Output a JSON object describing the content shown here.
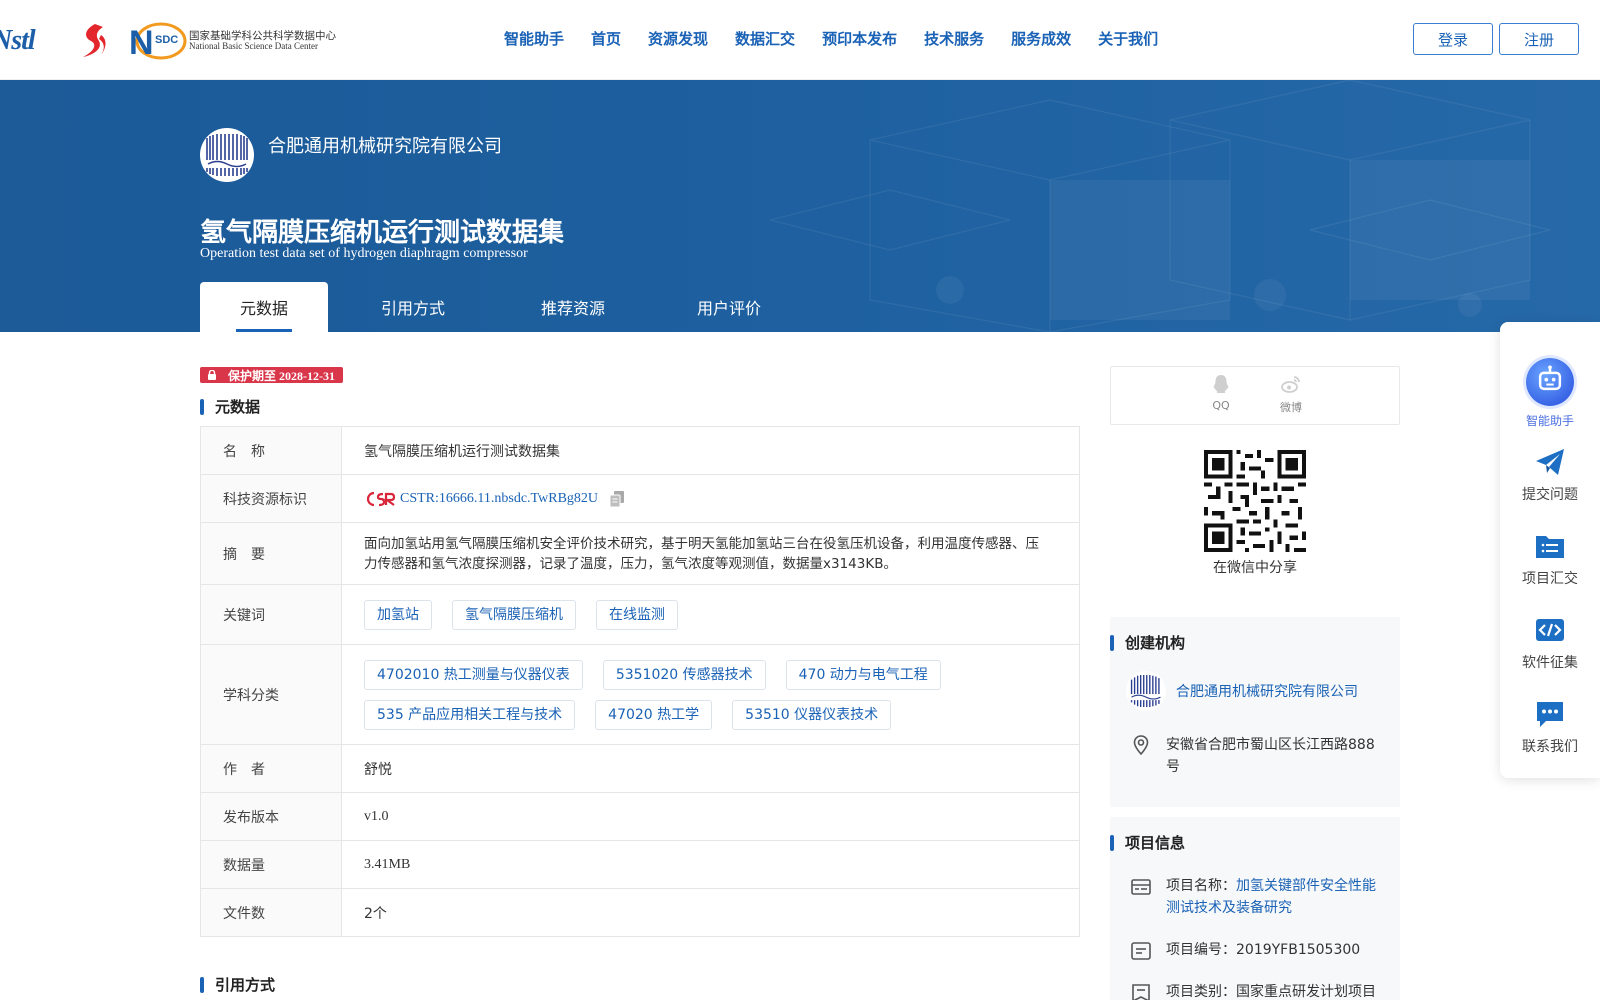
{
  "header": {
    "logos": {
      "nstl": "Nstl",
      "nsdc_mark": "SDC",
      "nsdc_cn": "国家基础学科公共科学数据中心",
      "nsdc_en": "National Basic Science Data Center"
    },
    "nav": [
      "智能助手",
      "首页",
      "资源发现",
      "数据汇交",
      "预印本发布",
      "技术服务",
      "服务成效",
      "关于我们"
    ],
    "login": "登录",
    "register": "注册"
  },
  "banner": {
    "org_name": "合肥通用机械研究院有限公司",
    "title": "氢气隔膜压缩机运行测试数据集",
    "title_en": "Operation test data set of hydrogen diaphragm compressor",
    "tabs": [
      "元数据",
      "引用方式",
      "推荐资源",
      "用户评价"
    ],
    "active_tab": 0
  },
  "protect_badge": "保护期至 2028-12-31",
  "metadata": {
    "section_title": "元数据",
    "rows": {
      "name": {
        "label": "名　称",
        "value": "氢气隔膜压缩机运行测试数据集"
      },
      "cstr": {
        "label": "科技资源标识",
        "value": "CSTR:16666.11.nbsdc.TwRBg82U"
      },
      "abstract": {
        "label": "摘　要",
        "value": "面向加氢站用氢气隔膜压缩机安全评价技术研究，基于明天氢能加氢站三台在役氢压机设备，利用温度传感器、压力传感器和氢气浓度探测器，记录了温度，压力，氢气浓度等观测值，数据量x3143KB。"
      },
      "keywords": {
        "label": "关键词",
        "tags": [
          "加氢站",
          "氢气隔膜压缩机",
          "在线监测"
        ]
      },
      "subjects": {
        "label": "学科分类",
        "rows": [
          [
            "4702010 热工测量与仪器仪表",
            "5351020 传感器技术",
            "470 动力与电气工程"
          ],
          [
            "535 产品应用相关工程与技术",
            "47020 热工学",
            "53510 仪器仪表技术"
          ]
        ]
      },
      "author": {
        "label": "作　者",
        "value": "舒悦"
      },
      "version": {
        "label": "发布版本",
        "value": "v1.0"
      },
      "size": {
        "label": "数据量",
        "value": "3.41MB"
      },
      "files": {
        "label": "文件数",
        "value": "2个"
      }
    }
  },
  "citation_section_title": "引用方式",
  "share": {
    "qq": "QQ",
    "weibo": "微博",
    "wechat_caption": "在微信中分享"
  },
  "org_panel": {
    "title": "创建机构",
    "org_name": "合肥通用机械研究院有限公司",
    "address": "安徽省合肥市蜀山区长江西路888号"
  },
  "project_panel": {
    "title": "项目信息",
    "name_label": "项目名称：",
    "name_value": "加氢关键部件安全性能测试技术及装备研究",
    "number": "项目编号：2019YFB1505300",
    "category": "项目类别：国家重点研发计划项目"
  },
  "float_bar": {
    "ai": "智能助手",
    "submit": "提交问题",
    "project": "项目汇交",
    "software": "软件征集",
    "contact": "联系我们"
  },
  "colors": {
    "brand_blue": "#1a62b5",
    "banner_blue": "#1d5f9f",
    "badge_red": "#d9364a"
  }
}
